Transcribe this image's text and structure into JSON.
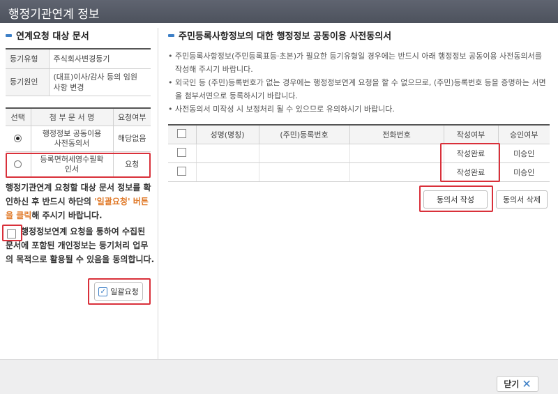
{
  "window": {
    "title": "행정기관연계 정보"
  },
  "left": {
    "section_title": "연계요청 대상 문서",
    "info": [
      {
        "label": "등기유형",
        "value": "주식회사변경등기"
      },
      {
        "label": "등기원인",
        "value": "(대표)이사/감사 등의 임원 사항 변경"
      }
    ],
    "doc_table": {
      "headers": [
        "선택",
        "첨 부 문 서 명",
        "요청여부"
      ],
      "rows": [
        {
          "name": "행정정보 공동이용 사전동의서",
          "status": "해당없음"
        },
        {
          "name": "등록면허세영수필확인서",
          "status": "요청"
        }
      ]
    },
    "notice": {
      "part1": "행정기관연계 요청할 대상 문서 정보를 확인하신 후 반드시 하단의 ",
      "highlight": "'일괄요청' 버튼을 클릭",
      "part2": "해 주시기 바랍니다."
    },
    "consent_text": "행정정보연계 요청을 통하여 수집된 문서에 포함된 개인정보는 등기처리 업무의 목적으로 활용될 수 있음을 동의합니다.",
    "bulk_request_label": "일괄요청"
  },
  "right": {
    "section_title": "주민등록사항정보의 대한 행정정보 공동이용 사전동의서",
    "guide": [
      "주민등록사항정보(주민등록표등·초본)가 필요한 등기유형일 경우에는 반드시 아래 행정정보 공동이용 사전동의서를 작성해 주시기 바랍니다.",
      "외국인 등 (주민)등록번호가 없는 경우에는 행정정보연계 요청을 할 수 없으므로, (주민)등록번호 등을 증명하는 서면을 첨부서면으로 등록하시기 바랍니다.",
      "사전동의서 미작성 시 보정처리 될 수 있으므로 유의하시기 바랍니다."
    ],
    "table": {
      "headers": [
        "",
        "성명(명칭)",
        "(주민)등록번호",
        "전화번호",
        "작성여부",
        "승인여부"
      ],
      "rows": [
        {
          "name": "",
          "reg_no": "",
          "phone": "",
          "written": "작성완료",
          "approved": "미승인"
        },
        {
          "name": "",
          "reg_no": "",
          "phone": "",
          "written": "작성완료",
          "approved": "미승인"
        }
      ]
    },
    "write_label": "동의서 작성",
    "delete_label": "동의서 삭제"
  },
  "footer": {
    "close_label": "닫기"
  }
}
